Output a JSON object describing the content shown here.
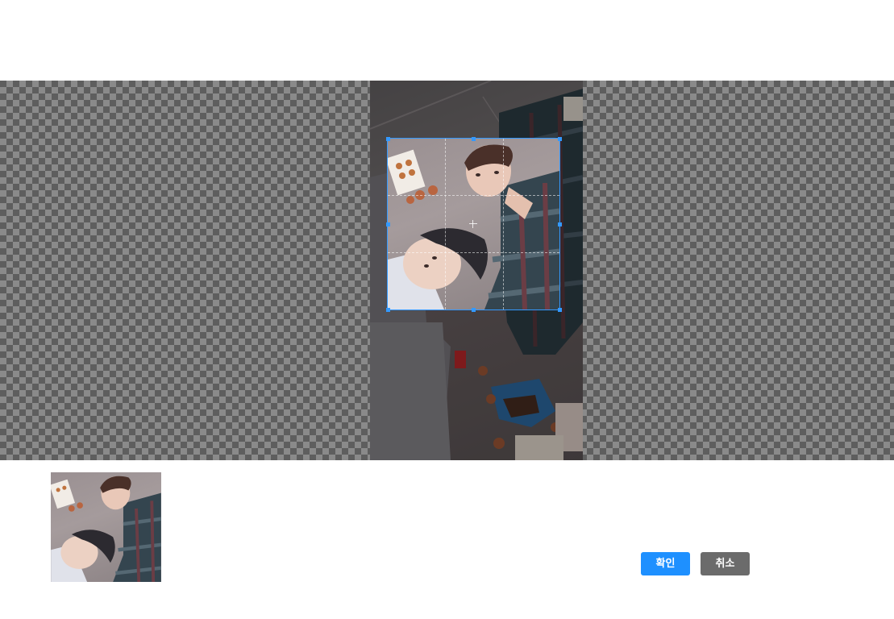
{
  "dialog": {
    "confirm_label": "확인",
    "cancel_label": "취소"
  },
  "colors": {
    "accent": "#1e90ff",
    "cancel": "#6b6b6b",
    "crop_outline": "#3399ff"
  }
}
